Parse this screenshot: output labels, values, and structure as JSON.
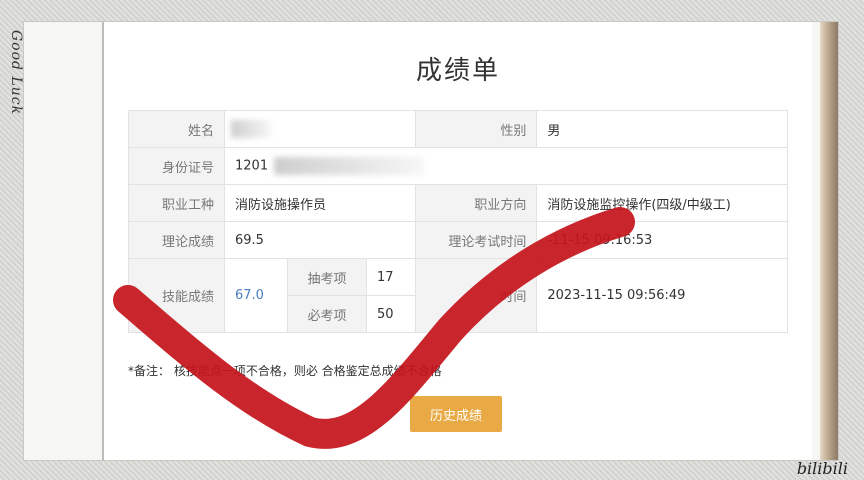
{
  "sticker_text": "Good Luck",
  "watermark": "bilibili",
  "title": "成绩单",
  "rows": {
    "name_label": "姓名",
    "gender_label": "性别",
    "gender_value": "男",
    "id_label": "身份证号",
    "id_value": "1201",
    "job_label": "职业工种",
    "job_value": "消防设施操作员",
    "direction_label": "职业方向",
    "direction_value": "消防设施监控操作(四级/中级工)",
    "theory_label": "理论成绩",
    "theory_value": "69.5",
    "theory_time_label": "理论考试时间",
    "theory_time_value": "-11-15 09:16:53",
    "skill_label": "技能成绩",
    "skill_value": "67.0",
    "draw_label": "抽考项",
    "draw_value": "17",
    "required_label": "必考项",
    "required_value": "50",
    "skill_time_label": "时间",
    "skill_time_value": "2023-11-15 09:56:49"
  },
  "note": "*备注：        核技能点一项不合格，则必          合格鉴定总成绩不合格",
  "history_button": "历史成绩",
  "colors": {
    "button": "#e9a944",
    "check_mark": "#c4161c",
    "skill_score": "#4a7fc1"
  }
}
